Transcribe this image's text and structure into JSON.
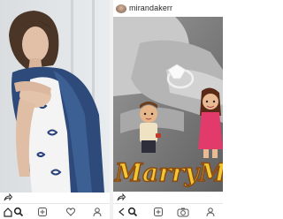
{
  "right_post": {
    "username": "mirandakerr",
    "image_text": "MarryMe"
  },
  "icons": {
    "action": [
      "share-icon"
    ],
    "nav": [
      "home-icon",
      "search-icon",
      "heart-icon",
      "profile-icon",
      "back-icon"
    ]
  }
}
